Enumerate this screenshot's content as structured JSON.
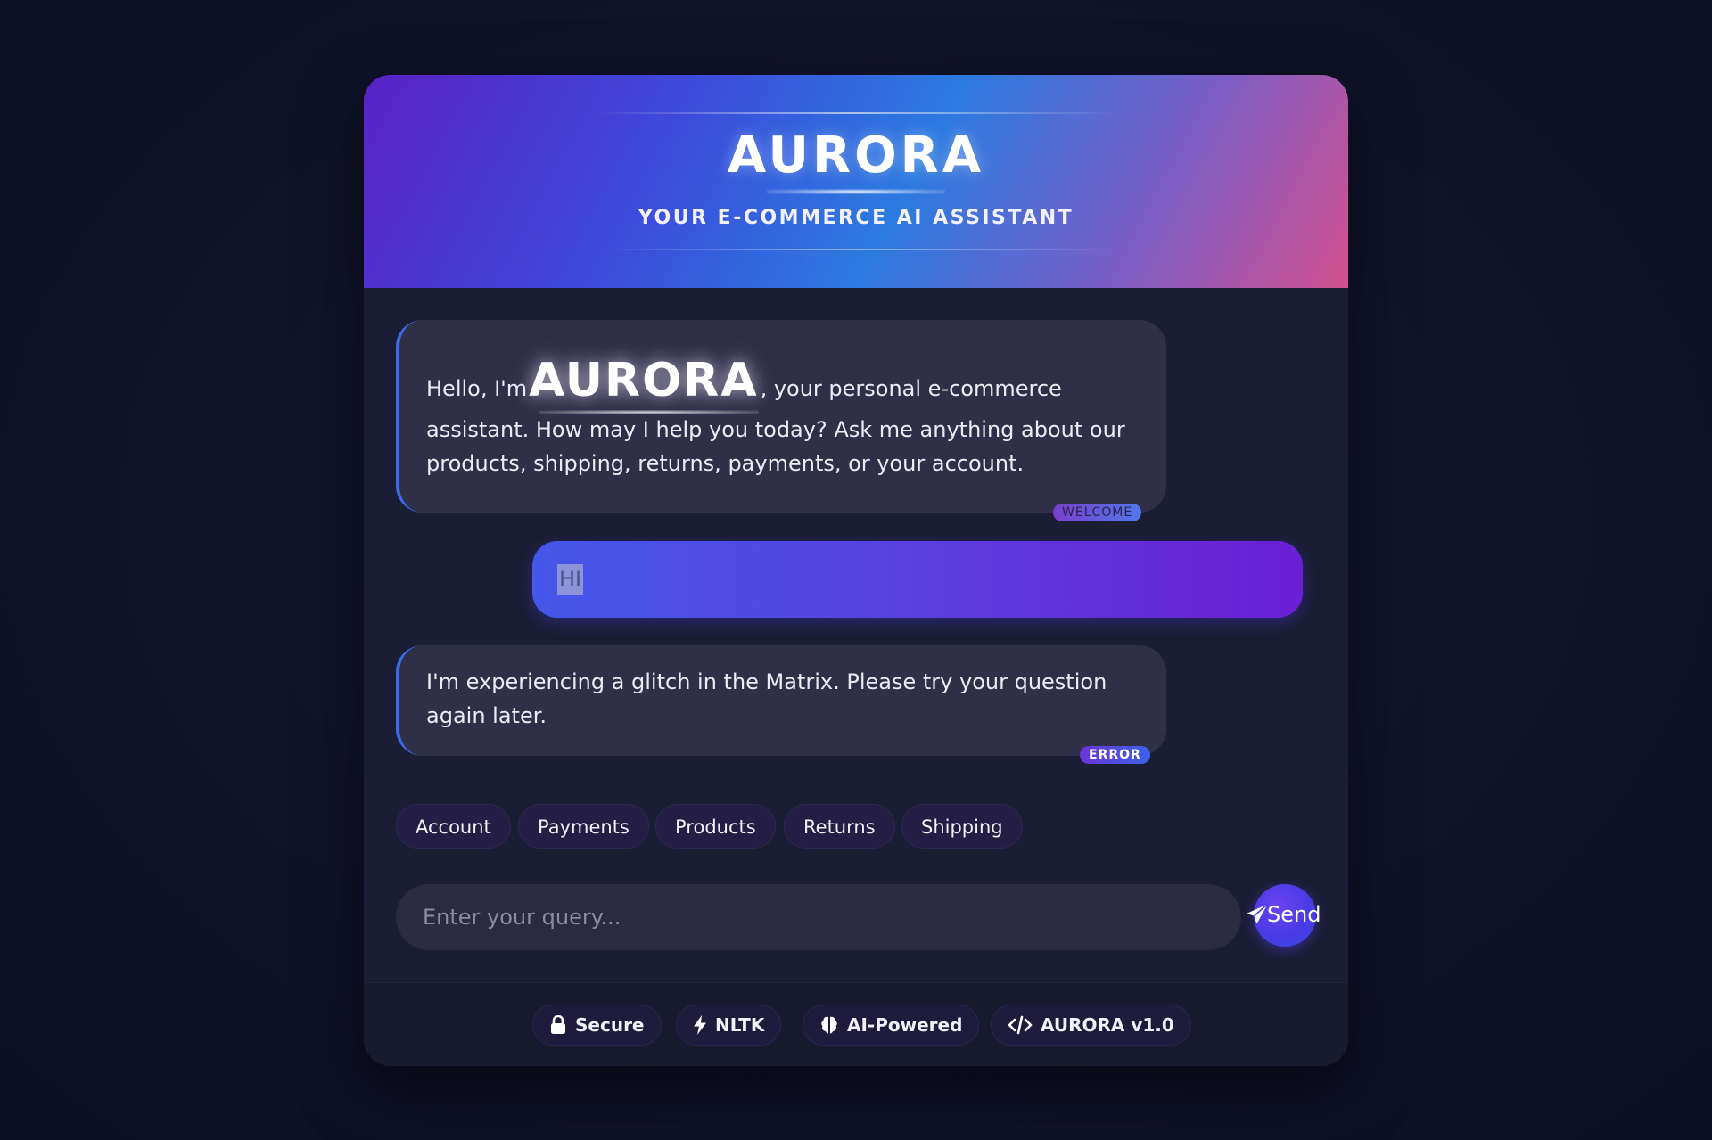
{
  "header": {
    "title": "AURORA",
    "subtitle": "YOUR E-COMMERCE AI ASSISTANT"
  },
  "messages": {
    "welcome": {
      "prefix": "Hello, I'm",
      "brand": "AURORA",
      "line1_suffix": ", your personal e-commerce",
      "rest": "assistant. How may I help you today? Ask me anything about our products, shipping, returns, payments, or your account.",
      "tag": "WELCOME"
    },
    "user": {
      "text": "HI"
    },
    "error": {
      "text": "I'm experiencing a glitch in the Matrix. Please try your question again later.",
      "tag": "ERROR"
    }
  },
  "quick_replies": [
    "Account",
    "Payments",
    "Products",
    "Returns",
    "Shipping"
  ],
  "input": {
    "placeholder": "Enter your query...",
    "value": ""
  },
  "send_button": {
    "label": "Send",
    "icon": "paper-plane-icon"
  },
  "footer_badges": [
    {
      "label": "Secure",
      "icon": "lock-icon"
    },
    {
      "label": "NLTK",
      "icon": "bolt-icon"
    },
    {
      "label": "AI-Powered",
      "icon": "brain-icon"
    },
    {
      "label": "AURORA v1.0",
      "icon": "code-icon"
    }
  ],
  "colors": {
    "background": "#10122a",
    "panel": "#1b1d34",
    "bot_bubble": "#2f3047",
    "accent_blue": "#3b6af0",
    "accent_purple": "#6a1fd4",
    "header_pink": "#d2508f"
  }
}
